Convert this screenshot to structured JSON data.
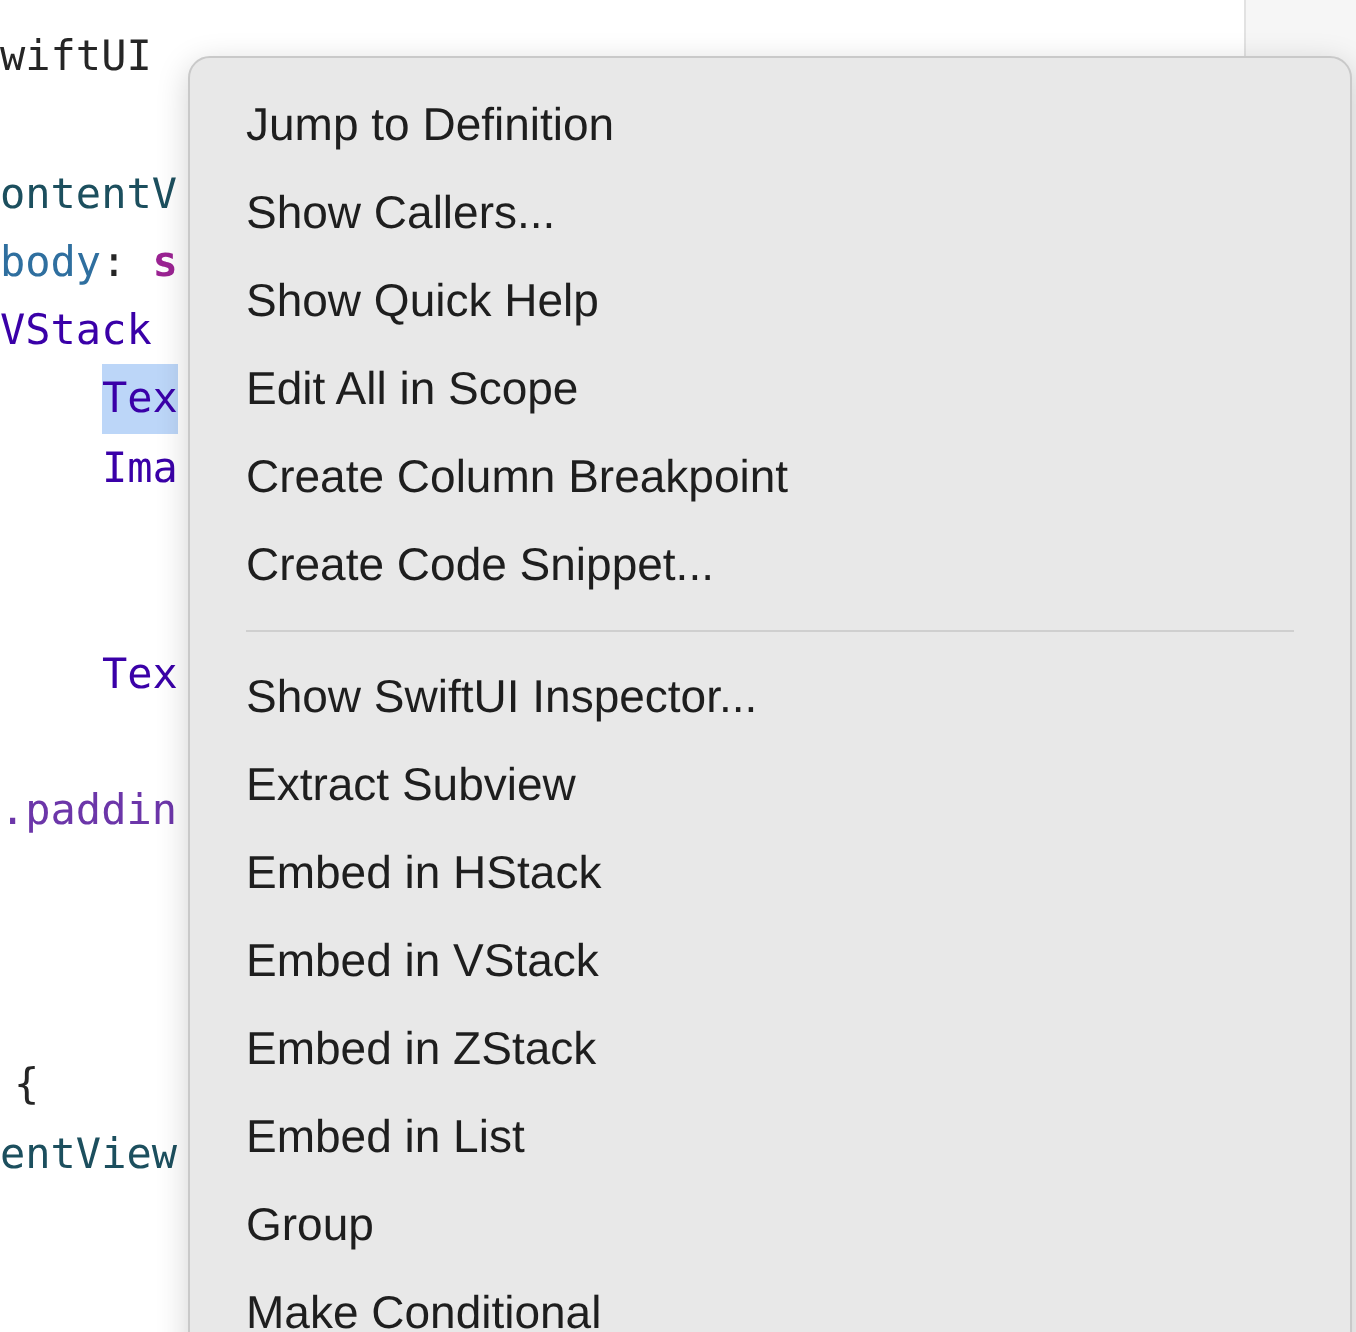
{
  "code_lines": [
    {
      "kind": "code",
      "indented": false,
      "tokens": [
        {
          "text": "wiftUI",
          "kind": "plain"
        }
      ]
    },
    {
      "kind": "blank"
    },
    {
      "kind": "code",
      "indented": false,
      "tokens": [
        {
          "text": "ontentV",
          "kind": "type"
        }
      ]
    },
    {
      "kind": "code",
      "indented": false,
      "tokens": [
        {
          "text": "body",
          "kind": "property"
        },
        {
          "text": ":",
          "kind": "plain"
        },
        {
          "text": "s",
          "kind": "keyword"
        }
      ]
    },
    {
      "kind": "code",
      "indented": false,
      "tokens": [
        {
          "text": "VStack",
          "kind": "builtin"
        }
      ]
    },
    {
      "kind": "code",
      "indented": true,
      "tokens": [
        {
          "text": "Tex",
          "kind": "selected"
        }
      ]
    },
    {
      "kind": "code",
      "indented": true,
      "tokens": [
        {
          "text": "Ima",
          "kind": "builtin"
        }
      ]
    },
    {
      "kind": "blank"
    },
    {
      "kind": "blank"
    },
    {
      "kind": "code",
      "indented": true,
      "tokens": [
        {
          "text": "Tex",
          "kind": "builtin"
        }
      ]
    },
    {
      "kind": "blank"
    },
    {
      "kind": "code",
      "indented": false,
      "tokens": [
        {
          "text": ".paddin",
          "kind": "method"
        }
      ]
    },
    {
      "kind": "blank"
    },
    {
      "kind": "blank"
    },
    {
      "kind": "blank"
    },
    {
      "kind": "code",
      "tokens": [
        {
          "text": "{",
          "kind": "brace"
        }
      ]
    },
    {
      "kind": "code",
      "indented": false,
      "tokens": [
        {
          "text": "entView",
          "kind": "type"
        }
      ]
    }
  ],
  "context_menu": {
    "items": [
      {
        "kind": "item",
        "label": "Jump to Definition"
      },
      {
        "kind": "item",
        "label": "Show Callers..."
      },
      {
        "kind": "item",
        "label": "Show Quick Help"
      },
      {
        "kind": "item",
        "label": "Edit All in Scope"
      },
      {
        "kind": "item",
        "label": "Create Column Breakpoint"
      },
      {
        "kind": "item",
        "label": "Create Code Snippet..."
      },
      {
        "kind": "separator"
      },
      {
        "kind": "item",
        "label": "Show SwiftUI Inspector..."
      },
      {
        "kind": "item",
        "label": "Extract Subview"
      },
      {
        "kind": "item",
        "label": "Embed in HStack"
      },
      {
        "kind": "item",
        "label": "Embed in VStack"
      },
      {
        "kind": "item",
        "label": "Embed in ZStack"
      },
      {
        "kind": "item",
        "label": "Embed in List"
      },
      {
        "kind": "item",
        "label": "Group"
      },
      {
        "kind": "item",
        "label": "Make Conditional"
      }
    ]
  }
}
